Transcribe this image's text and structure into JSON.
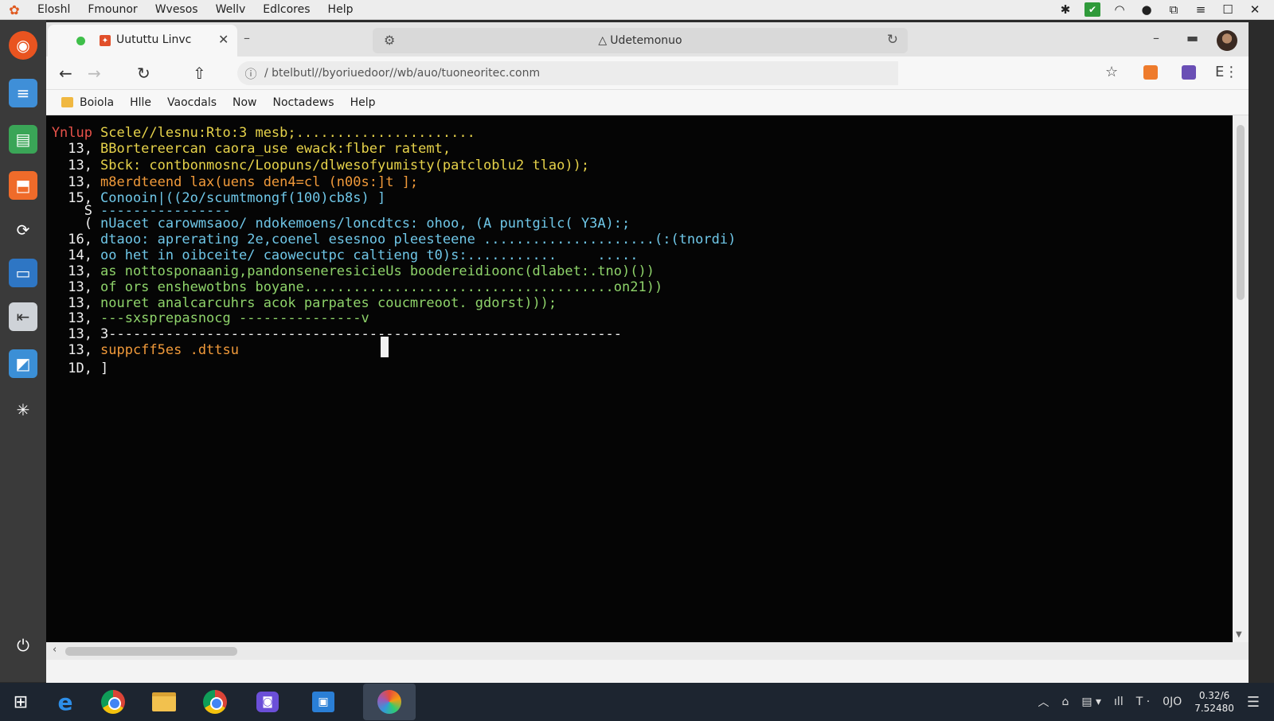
{
  "menubar": {
    "items": [
      "Eloshl",
      "Fmounor",
      "Wvesos",
      "Wellv",
      "Edlcores",
      "Help"
    ]
  },
  "browser": {
    "tab_title": "Uututtu Linvc",
    "window_search": "Udetemonuo",
    "url": "/ btelbutl//byoriuedoor//wb/auo/tuoneoritec.conm",
    "bookmarks": [
      "Boiola",
      "Hlle",
      "Vaocdals",
      "Now",
      "Noctadews",
      "Help"
    ]
  },
  "terminal": {
    "lines": [
      {
        "num": "Ynlup",
        "text": "Scele//lesnu:Rto:3 mesb;......................"
      },
      {
        "num": "13,",
        "text": "BBortereercan caora_use ewack:flber ratemt,"
      },
      {
        "num": "13,",
        "text": "Sbck: contbonmosnc/Loopuns/dlwesofyumisty(patcloblu2 tlao));"
      },
      {
        "num": "13,",
        "text": "m8erdteend lax(uens den4=cl (n00s:]t ];"
      },
      {
        "num": "15,",
        "text": "Conooin|((2o/scumtmongf(100)cb8s) ]"
      },
      {
        "num": "S",
        "text": "----------------"
      },
      {
        "num": "(",
        "text": "nUacet carowmsaoo/ ndokemoens/loncdtcs: ohoo, (A puntgilc( Y3A):;"
      },
      {
        "num": "16,",
        "text": "dtaoo: aprerating 2e,coenel esesnoo pleesteene .....................(:(tnordi)"
      },
      {
        "num": "14,",
        "text": "oo het in oibceite/ caowecutpc caltieng t0)s:...........     ....."
      },
      {
        "num": "13,",
        "text": "as nottosponaanig,pandonseneresicieUs boodereidioonc(dlabet:.tno)())"
      },
      {
        "num": "13,",
        "text": "of ors enshewotbns boyane......................................on21))"
      },
      {
        "num": "13,",
        "text": "nouret analcarcuhrs acok parpates coucmreoot. gdorst)));"
      },
      {
        "num": "13,",
        "text": "---sxsprepasnocg ---------------v"
      },
      {
        "num": "13,",
        "text": "3---------------------------------------------------------------"
      },
      {
        "num": "13,",
        "text": "suppcff5es .dttsu"
      },
      {
        "num": "1D,",
        "text": "]"
      }
    ]
  },
  "taskbar": {
    "time": "0.32/6",
    "date": "7.52480",
    "lang": "0JO"
  }
}
